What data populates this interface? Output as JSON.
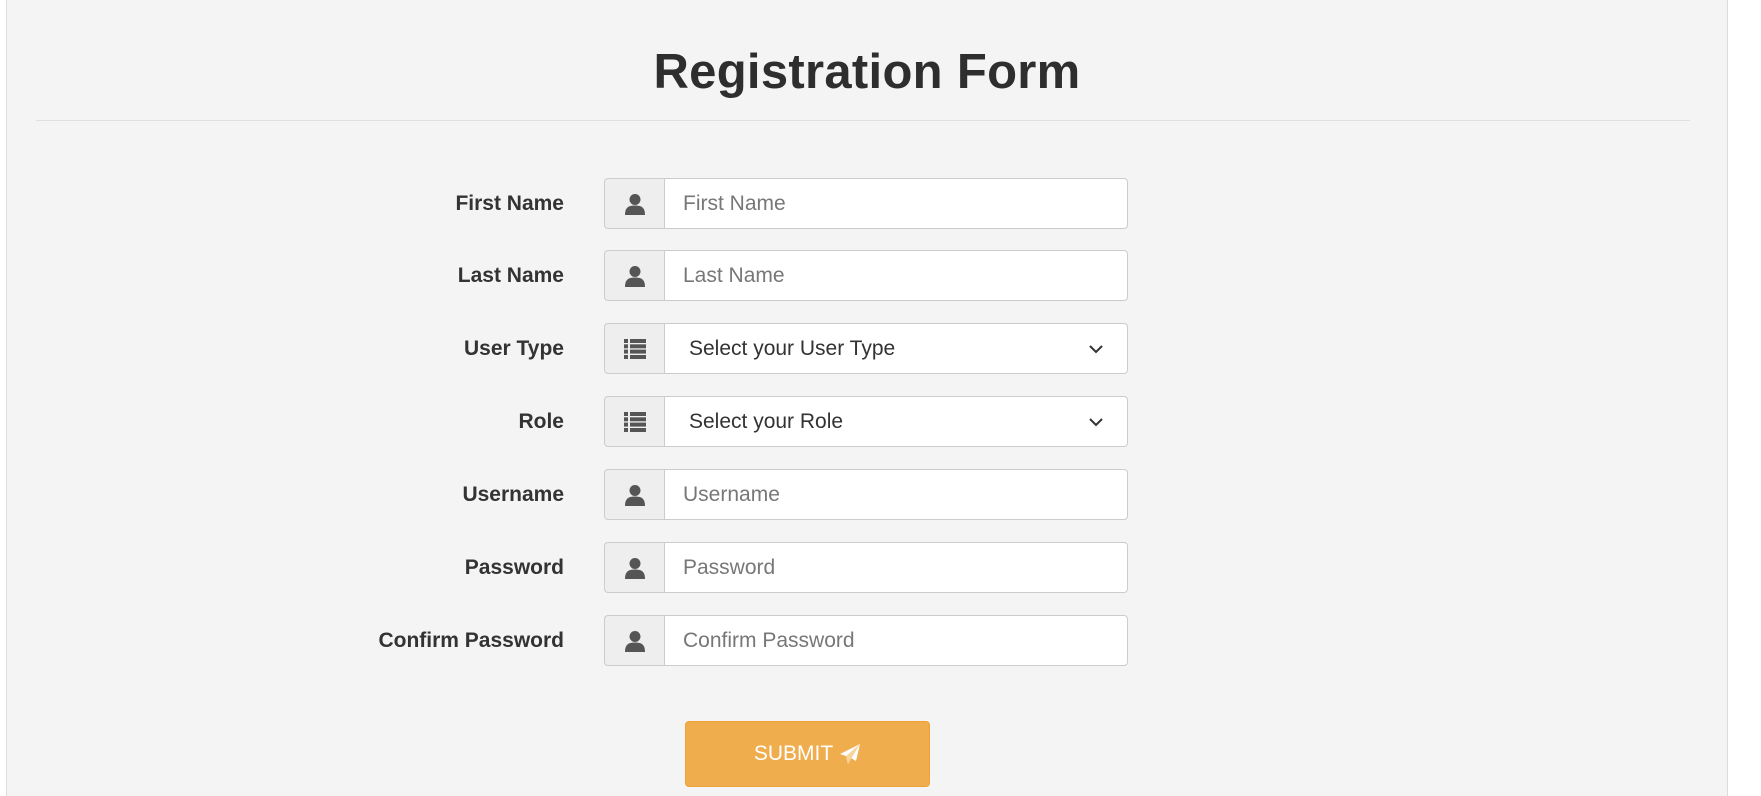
{
  "page": {
    "title": "Registration Form"
  },
  "form": {
    "first_name": {
      "label": "First Name",
      "placeholder": "First Name",
      "icon": "user-icon"
    },
    "last_name": {
      "label": "Last Name",
      "placeholder": "Last Name",
      "icon": "user-icon"
    },
    "user_type": {
      "label": "User Type",
      "selected": "Select your User Type",
      "icon": "list-icon"
    },
    "role": {
      "label": "Role",
      "selected": "Select your Role",
      "icon": "list-icon"
    },
    "username": {
      "label": "Username",
      "placeholder": "Username",
      "icon": "user-icon"
    },
    "password": {
      "label": "Password",
      "placeholder": "Password",
      "icon": "user-icon"
    },
    "confirm_password": {
      "label": "Confirm Password",
      "placeholder": "Confirm Password",
      "icon": "user-icon"
    },
    "submit": {
      "label": "SUBMIT",
      "icon": "paper-plane-icon"
    }
  },
  "colors": {
    "panel_bg": "#f4f4f4",
    "submit_bg": "#f0ad4e",
    "addon_bg": "#eeeeee",
    "icon_color": "#555555"
  }
}
